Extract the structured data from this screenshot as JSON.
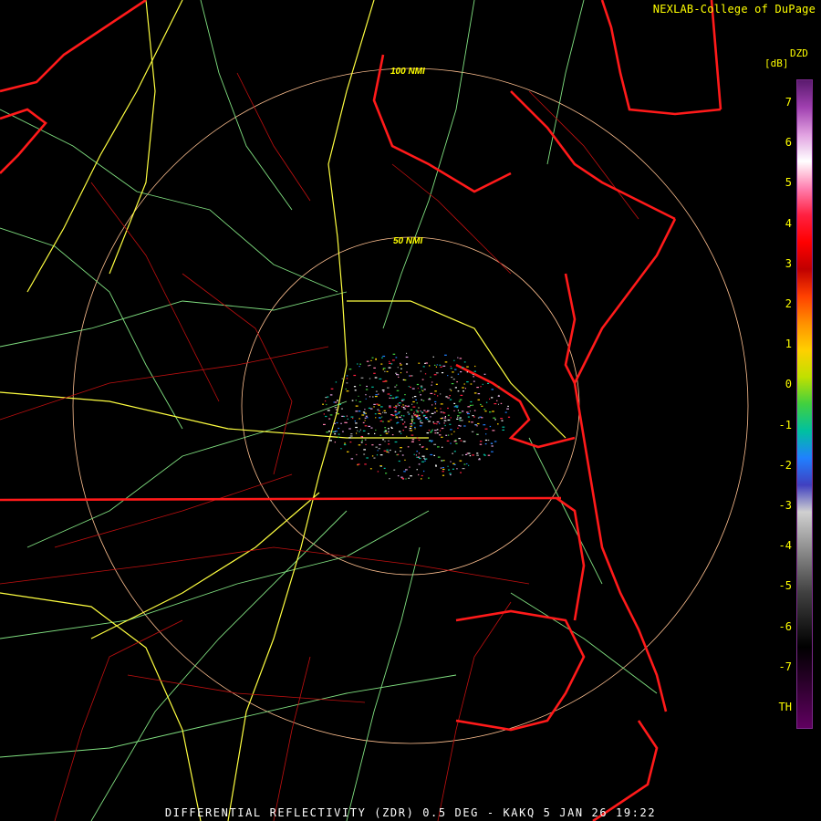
{
  "credit": "NEXLAB-College of DuPage",
  "legend": {
    "title": "DZD",
    "units": "[dB]",
    "ticks": [
      "7",
      "6",
      "5",
      "4",
      "3",
      "2",
      "1",
      "0",
      "-1",
      "-2",
      "-3",
      "-4",
      "-5",
      "-6",
      "-7",
      "TH"
    ],
    "colors": [
      "#5a1a6e",
      "#a040b0",
      "#e0a0e0",
      "#ffffff",
      "#ff80b0",
      "#ff2040",
      "#ff0000",
      "#c00000",
      "#ff4000",
      "#ff9000",
      "#ffd000",
      "#c0e000",
      "#40d040",
      "#00c0a0",
      "#2080ff",
      "#4040c0",
      "#d0d0d0",
      "#a0a0a0",
      "#707070",
      "#404040",
      "#202020",
      "#000000",
      "#200020",
      "#400040",
      "#600060"
    ]
  },
  "rings": [
    "100 NMI",
    "50 NMI"
  ],
  "caption": "DIFFERENTIAL REFLECTIVITY (ZDR) 0.5 DEG - KAKQ 5 JAN 26 19:22",
  "colors": {
    "state": "#ff1a1a",
    "county": "#c01010",
    "highway": "#ffff40",
    "road": "#80e080",
    "ring": "#ffc090"
  }
}
